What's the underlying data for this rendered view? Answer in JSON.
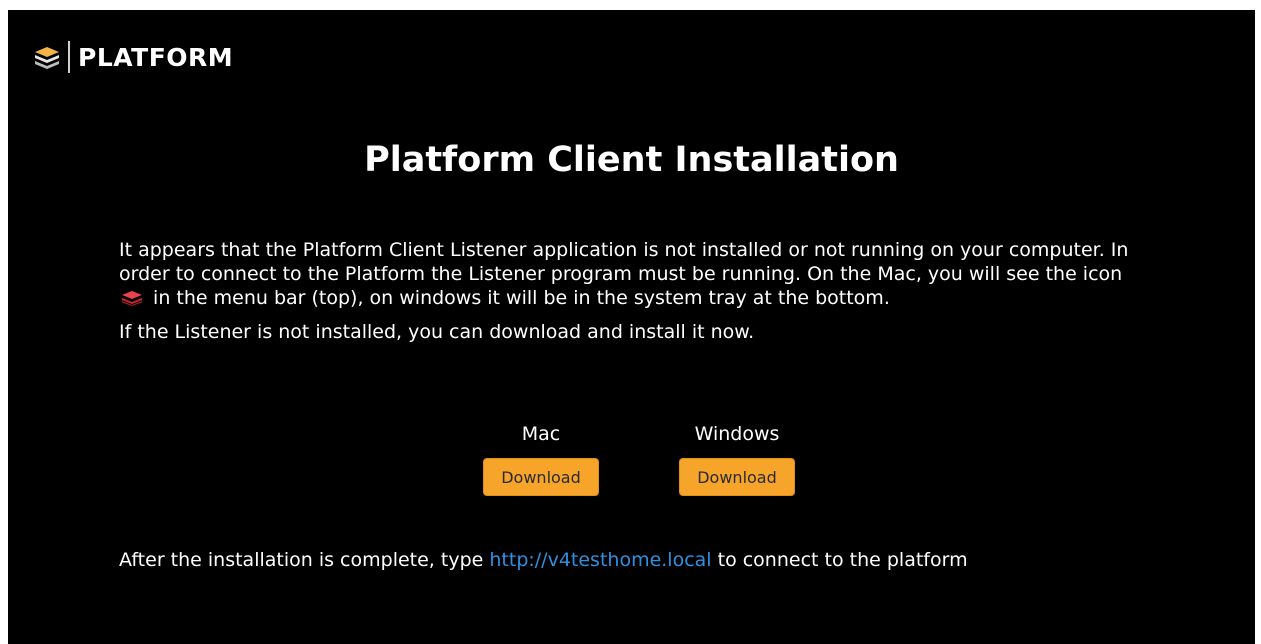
{
  "brand": {
    "name": "PLATFORM",
    "icon": "stacked-layers-icon"
  },
  "page": {
    "title": "Platform Client Installation",
    "intro_part1": "It appears that the Platform Client Listener application is not installed or not running on your computer. In order to connect to the Platform the Listener program must be running. On the Mac, you will see the icon",
    "intro_part2": "in the menu bar (top), on windows it will be in the system tray at the bottom.",
    "install_prompt": "If the Listener is not installed, you can download and install it now."
  },
  "downloads": [
    {
      "platform": "Mac",
      "button_label": "Download"
    },
    {
      "platform": "Windows",
      "button_label": "Download"
    }
  ],
  "footer": {
    "prefix": "After the installation is complete, type",
    "link_text": "http://v4testhome.local",
    "suffix": "to connect to the platform"
  },
  "colors": {
    "background": "#000000",
    "button": "#f6a42a",
    "link": "#2f8fe0",
    "menu_icon": "#d9363e"
  }
}
